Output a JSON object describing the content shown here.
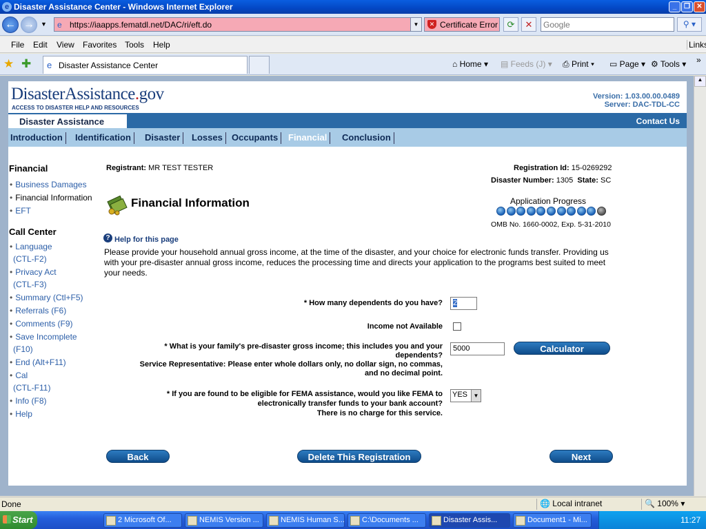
{
  "window": {
    "title": "Disaster Assistance Center - Windows Internet Explorer"
  },
  "browser": {
    "url": "https://iaapps.fematdl.net/DAC/ri/eft.do",
    "cert_error": "Certificate Error",
    "search_placeholder": "Google",
    "menu": [
      "File",
      "Edit",
      "View",
      "Favorites",
      "Tools",
      "Help"
    ],
    "links_label": "Links",
    "tab_title": "Disaster Assistance Center",
    "commands": {
      "home": "Home",
      "feeds": "Feeds (J)",
      "print": "Print",
      "page": "Page",
      "tools": "Tools"
    }
  },
  "site": {
    "logo_main": "DisasterAssistance",
    "logo_dot": ".",
    "logo_gov": "gov",
    "logo_tagline": "ACCESS TO DISASTER HELP AND RESOURCES",
    "version": "Version: 1.03.00.00.0489",
    "server": "Server: DAC-TDL-CC",
    "section_title": "Disaster Assistance",
    "contact_us": "Contact Us"
  },
  "nav_tabs": [
    "Introduction",
    "Identification",
    "Disaster",
    "Losses",
    "Occupants",
    "Financial",
    "Conclusion"
  ],
  "active_tab": "Financial",
  "sidebar": {
    "financial_heading": "Financial",
    "financial_items": [
      "Business Damages",
      "Financial Information",
      "EFT"
    ],
    "call_center_heading": "Call Center",
    "call_items": [
      {
        "line1": "Language",
        "line2": "(CTL-F2)"
      },
      {
        "line1": "Privacy Act",
        "line2": "(CTL-F3)"
      },
      {
        "line1": "Summary (Ctl+F5)",
        "line2": ""
      },
      {
        "line1": "Referrals (F6)",
        "line2": ""
      },
      {
        "line1": "Comments (F9)",
        "line2": ""
      },
      {
        "line1": "Save Incomplete",
        "line2": "(F10)"
      },
      {
        "line1": "End (Alt+F11)",
        "line2": ""
      },
      {
        "line1": "Cal",
        "line2": "(CTL-F11)"
      },
      {
        "line1": "Info (F8)",
        "line2": ""
      },
      {
        "line1": "Help",
        "line2": ""
      }
    ]
  },
  "registrant": {
    "label": "Registrant:",
    "name": "MR TEST TESTER",
    "reg_id_label": "Registration Id:",
    "reg_id": "15-0269292",
    "disaster_label": "Disaster Number:",
    "disaster_number": "1305",
    "state_label": "State:",
    "state": "SC"
  },
  "page": {
    "title": "Financial Information",
    "progress_label": "Application Progress",
    "progress": {
      "completed": 10,
      "total": 11
    },
    "omb": "OMB No. 1660-0002, Exp. 5-31-2010",
    "help_link": "Help for this page",
    "intro": "Please provide your household annual gross income, at the time of the disaster, and your choice for electronic funds transfer. Providing us with your pre-disaster annual gross income, reduces the processing time and directs your application to the programs best suited to meet your needs."
  },
  "form": {
    "q_dependents": "* How many dependents do you have?",
    "dependents_value": "2",
    "income_na_label": "Income not Available",
    "q_income_line1": "* What is your family's pre-disaster gross income; this includes you and your",
    "q_income_line2": "dependents?",
    "note_line1": "Service Representative: Please enter whole dollars only, no dollar sign, no commas,",
    "note_line2": "and no decimal point.",
    "income_value": "5000",
    "calculator": "Calculator",
    "q_eft_line1": "* If you are found to be eligible for FEMA assistance, would you like FEMA to",
    "q_eft_line2": "electronically transfer funds to your bank account?",
    "q_eft_line3": "There is no charge for this service.",
    "eft_value": "YES"
  },
  "buttons": {
    "back": "Back",
    "delete": "Delete This Registration",
    "next": "Next"
  },
  "status": {
    "left": "Done",
    "zone": "Local intranet",
    "zoom": "100%"
  },
  "taskbar": {
    "start": "Start",
    "items": [
      "2 Microsoft Of...",
      "NEMIS Version ...",
      "NEMIS Human S...",
      "C:\\Documents ...",
      "Disaster Assis...",
      "Document1 - Mi..."
    ],
    "clock": "11:27"
  }
}
